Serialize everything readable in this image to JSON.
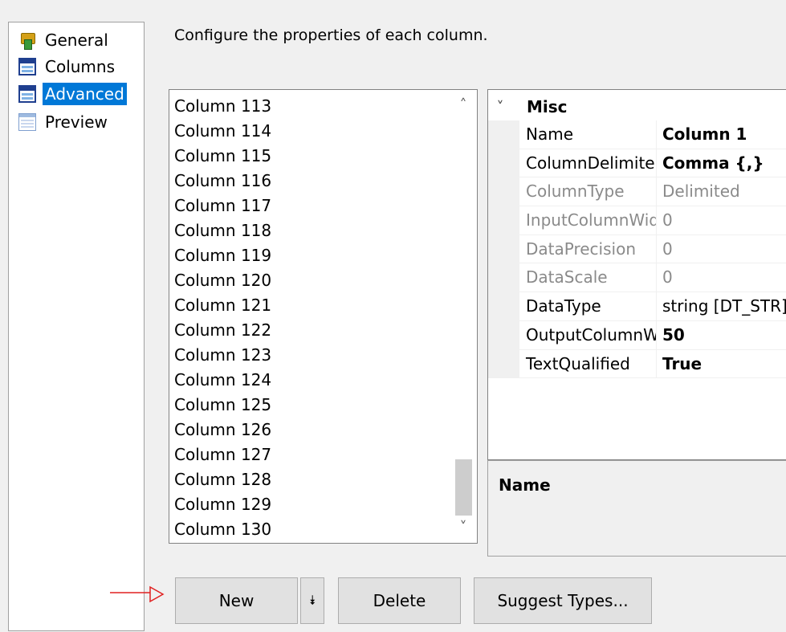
{
  "nav": {
    "items": [
      {
        "label": "General",
        "icon": "general-icon",
        "selected": false
      },
      {
        "label": "Columns",
        "icon": "table-icon",
        "selected": false
      },
      {
        "label": "Advanced",
        "icon": "table-icon",
        "selected": true
      },
      {
        "label": "Preview",
        "icon": "preview-icon",
        "selected": false
      }
    ],
    "selected_color": "#0078d7"
  },
  "instruction": "Configure the properties of each column.",
  "column_list": {
    "items": [
      "Column 113",
      "Column 114",
      "Column 115",
      "Column 116",
      "Column 117",
      "Column 118",
      "Column 119",
      "Column 120",
      "Column 121",
      "Column 122",
      "Column 123",
      "Column 124",
      "Column 125",
      "Column 126",
      "Column 127",
      "Column 128",
      "Column 129",
      "Column 130"
    ],
    "scroll_up": "˄",
    "scroll_down": "˅"
  },
  "property_grid": {
    "category_chevron": "˅",
    "category": "Misc",
    "rows": [
      {
        "name": "Name",
        "value": "Column 1"
      },
      {
        "name": "ColumnDelimiter",
        "value": "Comma {,}"
      },
      {
        "name": "ColumnType",
        "value": "Delimited"
      },
      {
        "name": "InputColumnWidth",
        "value": "0"
      },
      {
        "name": "DataPrecision",
        "value": "0"
      },
      {
        "name": "DataScale",
        "value": "0"
      },
      {
        "name": "DataType",
        "value": "string [DT_STR]"
      },
      {
        "name": "OutputColumnWidth",
        "value": "50"
      },
      {
        "name": "TextQualified",
        "value": "True"
      }
    ]
  },
  "description": {
    "title": "Name"
  },
  "buttons": {
    "new": "New",
    "new_dropdown": "⯯",
    "delete": "Delete",
    "suggest_types": "Suggest Types..."
  },
  "annotation_color": "#e02020"
}
